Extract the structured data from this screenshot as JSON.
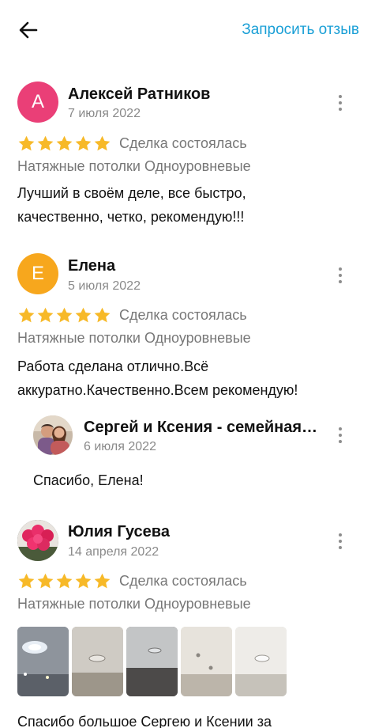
{
  "header": {
    "back_icon": "arrow-left-icon",
    "request_label": "Запросить отзыв",
    "accent_color": "#1a9fd6"
  },
  "colors": {
    "star": "#f7b928",
    "muted": "#8a8a8a"
  },
  "reviews": [
    {
      "avatar_letter": "А",
      "avatar_color": "#ea3f77",
      "name": "Алексей Ратников",
      "date": "7 июля 2022",
      "rating": 5,
      "status": "Сделка состоялась",
      "category": "Натяжные потолки Одноуровневые",
      "text_lines": [
        "Лучший в своём деле, все быстро,",
        "качественно, четко, рекомендую!!!"
      ]
    },
    {
      "avatar_letter": "Е",
      "avatar_color": "#f7a71d",
      "name": "Елена",
      "date": "5 июля 2022",
      "rating": 5,
      "status": "Сделка состоялась",
      "category": "Натяжные потолки Одноуровневые",
      "text_lines": [
        "Работа сделана отлично.Всё",
        "аккуратно.Качественно.Всем рекомендую!"
      ],
      "reply": {
        "name": "Сергей и Ксения - семейная пара мастеров",
        "date": "6 июля 2022",
        "text": "Спасибо, Елена!"
      }
    },
    {
      "avatar_image": "roses-photo",
      "name": "Юлия Гусева",
      "date": "14 апреля 2022",
      "rating": 5,
      "status": "Сделка состоялась",
      "category": "Натяжные потолки Одноуровневые",
      "photos": [
        "ceiling-photo-1",
        "ceiling-photo-2",
        "ceiling-photo-3",
        "ceiling-photo-4",
        "ceiling-photo-5"
      ],
      "text_lines": [
        "Спасибо большое Сергею и Ксении за"
      ]
    }
  ]
}
